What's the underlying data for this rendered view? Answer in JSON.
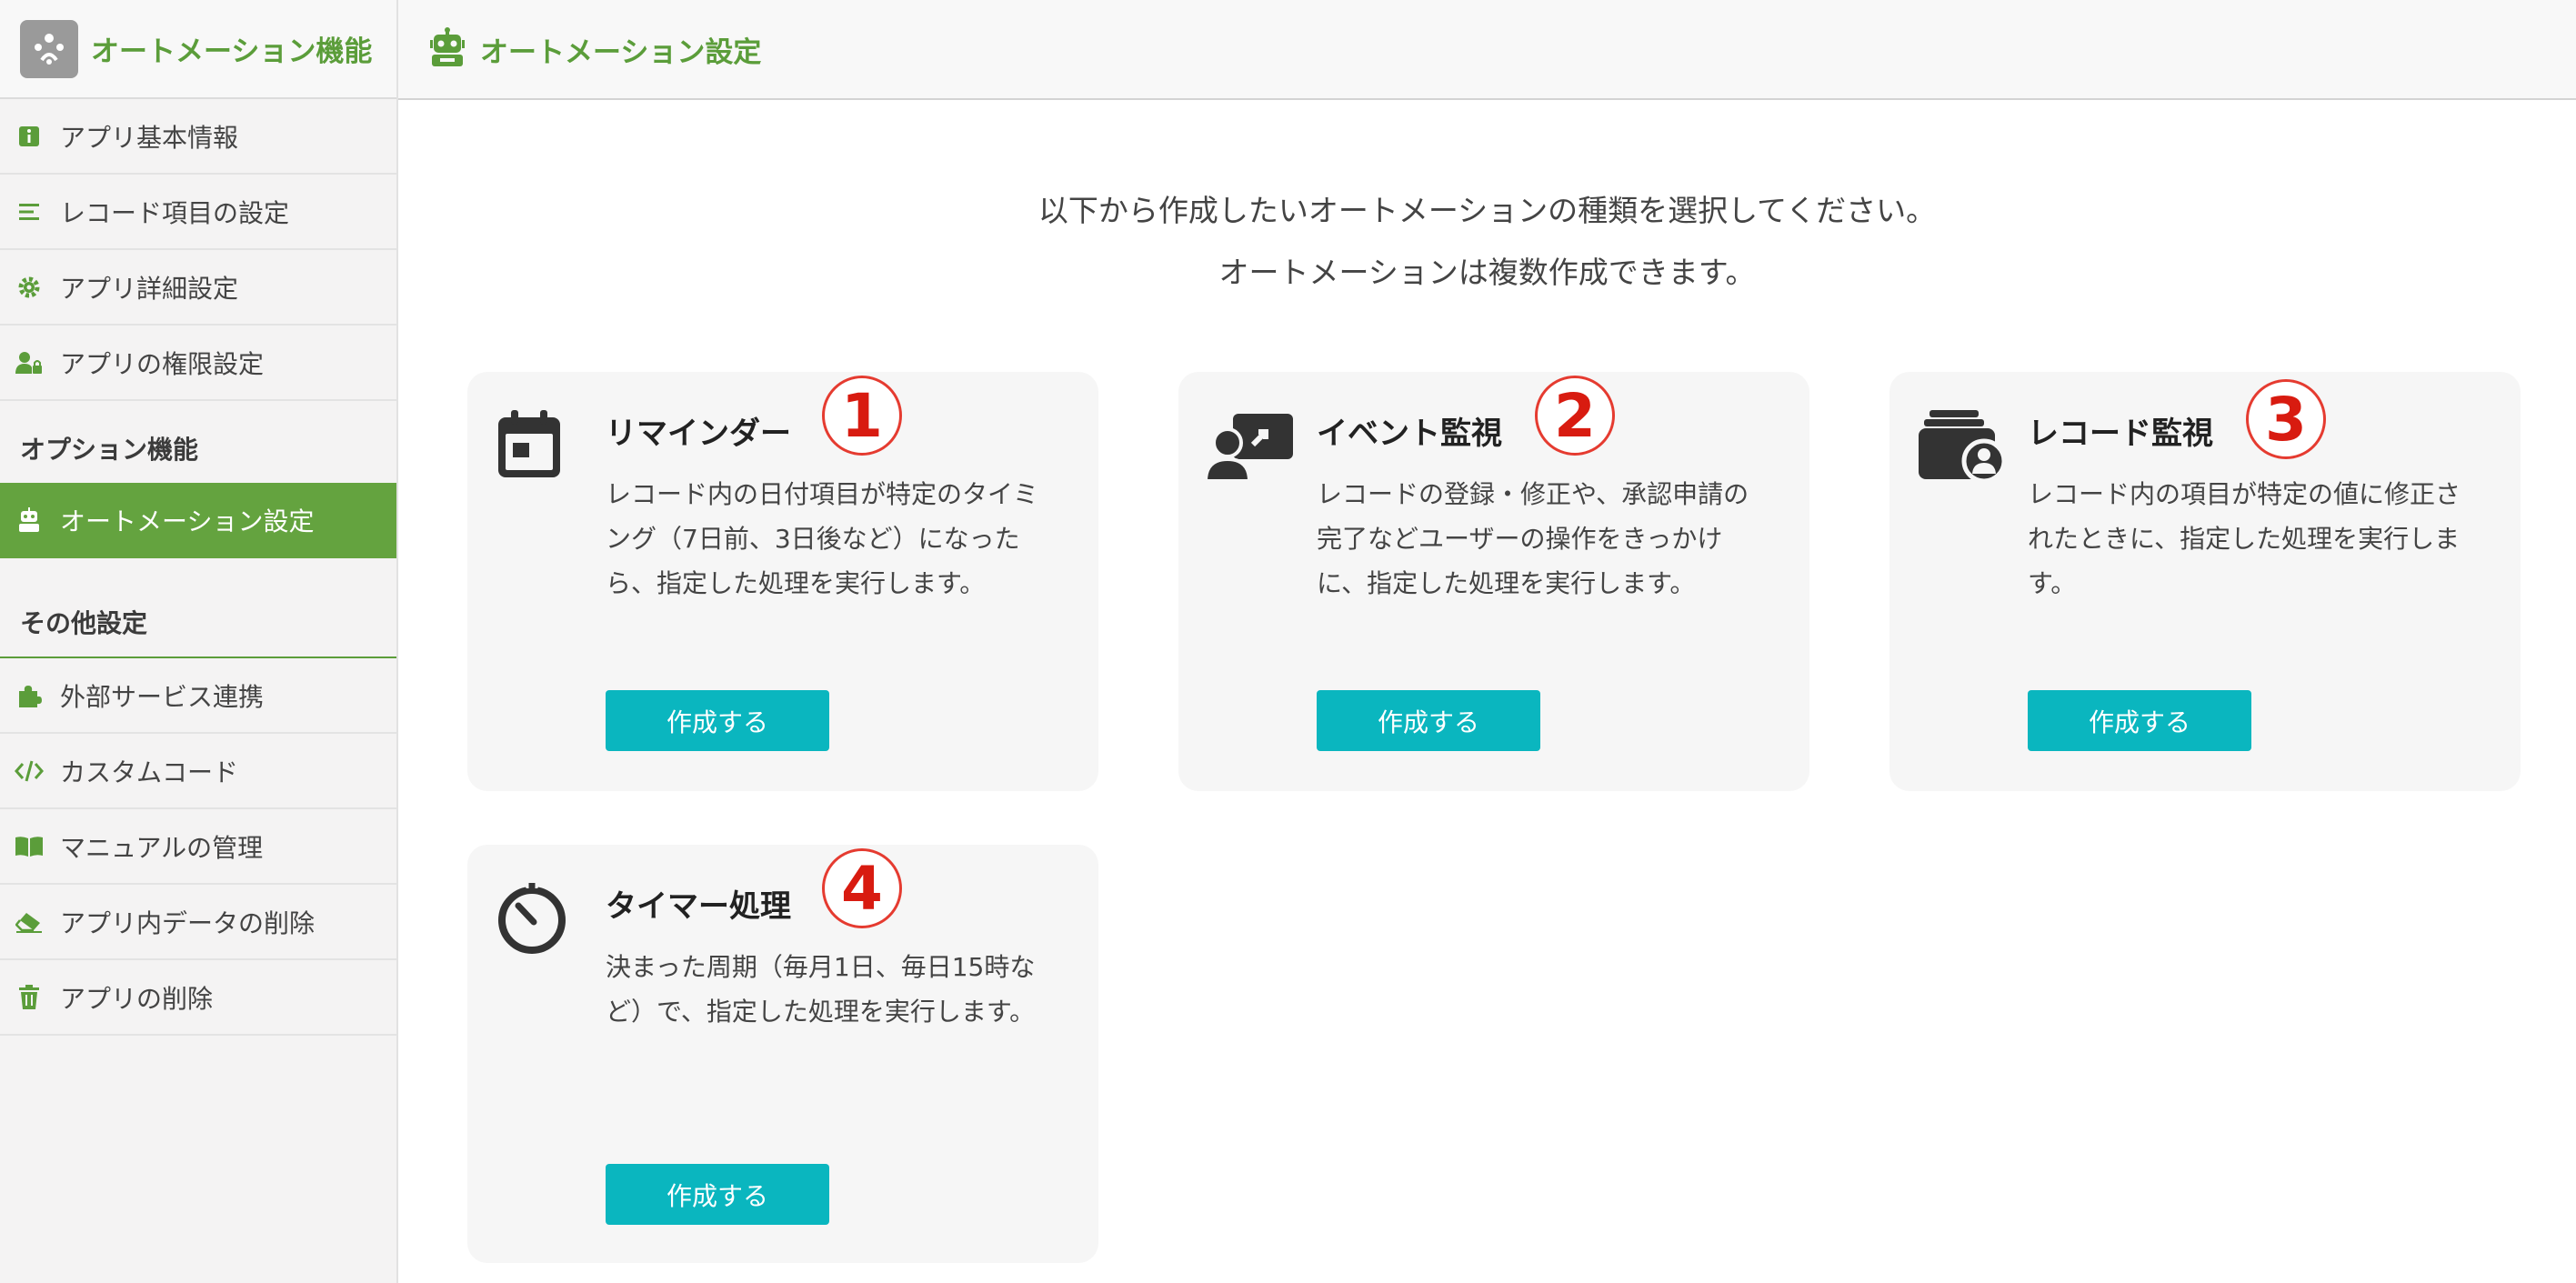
{
  "sidebar": {
    "app_name": "オートメーション機能",
    "items_top": [
      {
        "label": "アプリ基本情報",
        "icon": "info-icon"
      },
      {
        "label": "レコード項目の設定",
        "icon": "list-icon"
      },
      {
        "label": "アプリ詳細設定",
        "icon": "gear-icon"
      },
      {
        "label": "アプリの権限設定",
        "icon": "user-lock-icon"
      }
    ],
    "section_options": "オプション機能",
    "automation_item": {
      "label": "オートメーション設定",
      "icon": "robot-icon"
    },
    "section_other": "その他設定",
    "items_other": [
      {
        "label": "外部サービス連携",
        "icon": "puzzle-icon"
      },
      {
        "label": "カスタムコード",
        "icon": "code-icon"
      },
      {
        "label": "マニュアルの管理",
        "icon": "book-icon"
      },
      {
        "label": "アプリ内データの削除",
        "icon": "eraser-icon"
      },
      {
        "label": "アプリの削除",
        "icon": "trash-icon"
      }
    ]
  },
  "header": {
    "title": "オートメーション設定",
    "icon": "robot-icon"
  },
  "intro": {
    "line1": "以下から作成したいオートメーションの種類を選択してください。",
    "line2": "オートメーションは複数作成できます。"
  },
  "colors": {
    "accent": "#5b9d3a",
    "button": "#0ab6bf",
    "badge": "#d81b10"
  },
  "cards": [
    {
      "title": "リマインダー",
      "badge": "1",
      "icon": "calendar-icon",
      "desc": "レコード内の日付項目が特定のタイミング（7日前、3日後など）になったら、指定した処理を実行します。",
      "button": "作成する"
    },
    {
      "title": "イベント監視",
      "badge": "2",
      "icon": "user-monitor-icon",
      "desc": "レコードの登録・修正や、承認申請の完了などユーザーの操作をきっかけに、指定した処理を実行します。",
      "button": "作成する"
    },
    {
      "title": "レコード監視",
      "badge": "3",
      "icon": "wallet-user-icon",
      "desc": "レコード内の項目が特定の値に修正されたときに、指定した処理を実行します。",
      "button": "作成する"
    },
    {
      "title": "タイマー処理",
      "badge": "4",
      "icon": "timer-icon",
      "desc": "決まった周期（毎月1日、毎日15時など）で、指定した処理を実行します。",
      "button": "作成する"
    }
  ]
}
